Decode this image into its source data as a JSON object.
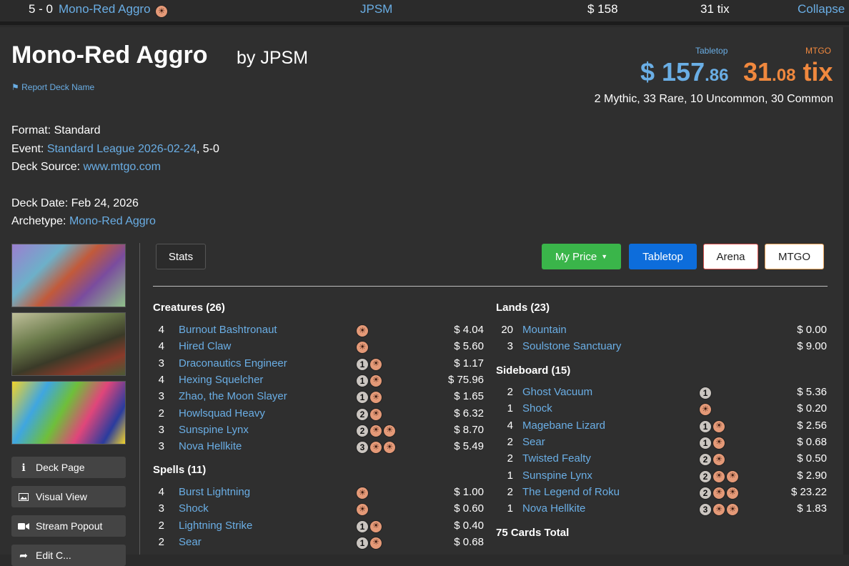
{
  "top_row": {
    "record": "5 - 0",
    "deck_name": "Mono-Red Aggro",
    "player": "JPSM",
    "price": "$ 158",
    "tix": "31 tix",
    "collapse_label": "Collapse"
  },
  "header": {
    "title": "Mono-Red Aggro",
    "byline": "by JPSM",
    "report_label": "Report Deck Name",
    "tabletop_label": "Tabletop",
    "tabletop_price_main": "$ 157",
    "tabletop_price_cents": ".86",
    "mtgo_label": "MTGO",
    "mtgo_price_main": "31",
    "mtgo_price_cents": ".08",
    "mtgo_unit": "tix",
    "rarity_summary": "2 Mythic, 33 Rare, 10 Uncommon, 30 Common"
  },
  "info": {
    "format_label": "Format:",
    "format_value": "Standard",
    "event_label": "Event:",
    "event_link": "Standard League 2026-02-24",
    "event_suffix": ", 5-0",
    "source_label": "Deck Source:",
    "source_link": "www.mtgo.com",
    "date_label": "Deck Date:",
    "date_value": "Feb 24, 2026",
    "archetype_label": "Archetype:",
    "archetype_link": "Mono-Red Aggro"
  },
  "sidebar": {
    "buttons": [
      {
        "label": "Deck Page",
        "icon": "info-icon"
      },
      {
        "label": "Visual View",
        "icon": "image-icon"
      },
      {
        "label": "Stream Popout",
        "icon": "video-camera-icon"
      },
      {
        "label": "Edit C...",
        "icon": "share-icon"
      }
    ]
  },
  "toolbar": {
    "stats_label": "Stats",
    "my_price_label": "My Price",
    "tabletop_label": "Tabletop",
    "arena_label": "Arena",
    "mtgo_label": "MTGO"
  },
  "colors": {
    "link": "#6aaee5",
    "tabletop_price": "#6aaee5",
    "mtgo_price": "#f0883e",
    "my_price_button": "#3ab54a",
    "tabletop_button": "#0d6ddb",
    "arena_border": "#d9534f",
    "mtgo_border": "#e8a45a",
    "red_mana": "#e49977",
    "generic_mana": "#cac5c0"
  },
  "sections": {
    "creatures": {
      "title": "Creatures (26)",
      "cards": [
        {
          "qty": "4",
          "name": "Burnout Bashtronaut",
          "cost": [
            "R"
          ],
          "price": "$ 4.04"
        },
        {
          "qty": "4",
          "name": "Hired Claw",
          "cost": [
            "R"
          ],
          "price": "$ 5.60"
        },
        {
          "qty": "3",
          "name": "Draconautics Engineer",
          "cost": [
            "1",
            "R"
          ],
          "price": "$ 1.17"
        },
        {
          "qty": "4",
          "name": "Hexing Squelcher",
          "cost": [
            "1",
            "R"
          ],
          "price": "$ 75.96"
        },
        {
          "qty": "3",
          "name": "Zhao, the Moon Slayer",
          "cost": [
            "1",
            "R"
          ],
          "price": "$ 1.65"
        },
        {
          "qty": "2",
          "name": "Howlsquad Heavy",
          "cost": [
            "2",
            "R"
          ],
          "price": "$ 6.32"
        },
        {
          "qty": "3",
          "name": "Sunspine Lynx",
          "cost": [
            "2",
            "R",
            "R"
          ],
          "price": "$ 8.70"
        },
        {
          "qty": "3",
          "name": "Nova Hellkite",
          "cost": [
            "3",
            "R",
            "R"
          ],
          "price": "$ 5.49"
        }
      ]
    },
    "spells": {
      "title": "Spells (11)",
      "cards": [
        {
          "qty": "4",
          "name": "Burst Lightning",
          "cost": [
            "R"
          ],
          "price": "$ 1.00"
        },
        {
          "qty": "3",
          "name": "Shock",
          "cost": [
            "R"
          ],
          "price": "$ 0.60"
        },
        {
          "qty": "2",
          "name": "Lightning Strike",
          "cost": [
            "1",
            "R"
          ],
          "price": "$ 0.40"
        },
        {
          "qty": "2",
          "name": "Sear",
          "cost": [
            "1",
            "R"
          ],
          "price": "$ 0.68"
        }
      ]
    },
    "lands": {
      "title": "Lands (23)",
      "cards": [
        {
          "qty": "20",
          "name": "Mountain",
          "cost": [],
          "price": "$ 0.00"
        },
        {
          "qty": "3",
          "name": "Soulstone Sanctuary",
          "cost": [],
          "price": "$ 9.00"
        }
      ]
    },
    "sideboard": {
      "title": "Sideboard (15)",
      "cards": [
        {
          "qty": "2",
          "name": "Ghost Vacuum",
          "cost": [
            "1"
          ],
          "price": "$ 5.36"
        },
        {
          "qty": "1",
          "name": "Shock",
          "cost": [
            "R"
          ],
          "price": "$ 0.20"
        },
        {
          "qty": "4",
          "name": "Magebane Lizard",
          "cost": [
            "1",
            "R"
          ],
          "price": "$ 2.56"
        },
        {
          "qty": "2",
          "name": "Sear",
          "cost": [
            "1",
            "R"
          ],
          "price": "$ 0.68"
        },
        {
          "qty": "2",
          "name": "Twisted Fealty",
          "cost": [
            "2",
            "R"
          ],
          "price": "$ 0.50"
        },
        {
          "qty": "1",
          "name": "Sunspine Lynx",
          "cost": [
            "2",
            "R",
            "R"
          ],
          "price": "$ 2.90"
        },
        {
          "qty": "2",
          "name": "The Legend of Roku",
          "cost": [
            "2",
            "R",
            "R"
          ],
          "price": "$ 23.22"
        },
        {
          "qty": "1",
          "name": "Nova Hellkite",
          "cost": [
            "3",
            "R",
            "R"
          ],
          "price": "$ 1.83"
        }
      ]
    },
    "total_label": "75 Cards Total"
  }
}
